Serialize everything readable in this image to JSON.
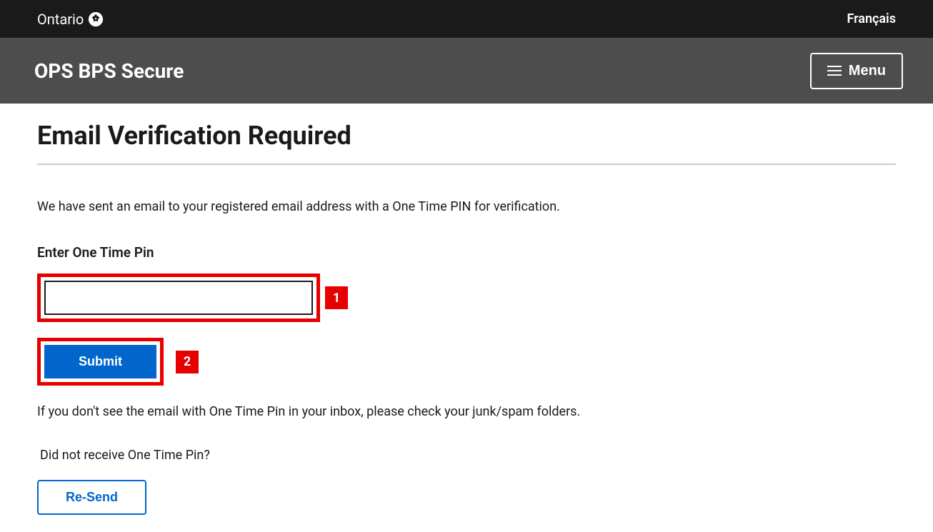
{
  "header": {
    "brand": "Ontario",
    "language_link": "Français",
    "app_title": "OPS BPS Secure",
    "menu_label": "Menu"
  },
  "main": {
    "title": "Email Verification Required",
    "intro": "We have sent an email to your registered email address with a One Time PIN for verification.",
    "pin_label": "Enter One Time Pin",
    "pin_value": "",
    "submit_label": "Submit",
    "hint": "If you don't see the email with One Time Pin in your inbox, please check your junk/spam folders.",
    "resend_prompt": "Did not receive One Time Pin?",
    "resend_label": "Re-Send"
  },
  "annotations": {
    "callout_1": "1",
    "callout_2": "2"
  }
}
